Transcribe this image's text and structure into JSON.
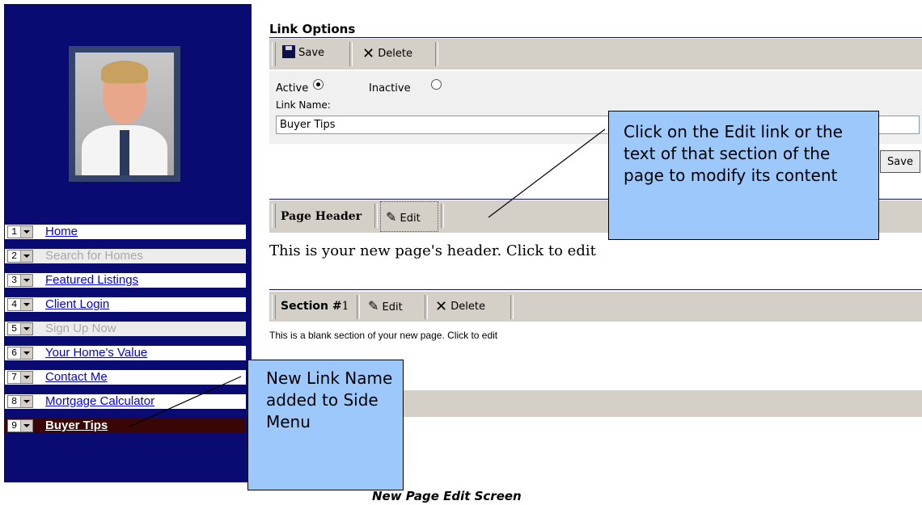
{
  "link_options": {
    "title": "Link Options",
    "save_label": "Save",
    "delete_label": "Delete",
    "active_label": "Active",
    "inactive_label": "Inactive",
    "link_name_label": "Link Name:",
    "link_name_value": "Buyer Tips",
    "save_button_label": "Save"
  },
  "page_header": {
    "title": "Page Header",
    "edit_label": "Edit",
    "content": "This is your new page's header. Click to edit"
  },
  "section1": {
    "title": "Section #",
    "number": "1",
    "edit_label": "Edit",
    "delete_label": "Delete",
    "content": "This is a blank section of your new page. Click to edit"
  },
  "nav": {
    "items": [
      {
        "num": "1",
        "label": "Home",
        "state": "normal"
      },
      {
        "num": "2",
        "label": "Search for Homes",
        "state": "disabled"
      },
      {
        "num": "3",
        "label": "Featured Listings",
        "state": "normal"
      },
      {
        "num": "4",
        "label": "Client Login",
        "state": "normal"
      },
      {
        "num": "5",
        "label": "Sign Up Now",
        "state": "disabled"
      },
      {
        "num": "6",
        "label": "Your Home's Value",
        "state": "normal"
      },
      {
        "num": "7",
        "label": "Contact Me",
        "state": "normal"
      },
      {
        "num": "8",
        "label": "Mortgage Calculator",
        "state": "normal"
      },
      {
        "num": "9",
        "label": "Buyer Tips",
        "state": "selected"
      }
    ]
  },
  "callouts": {
    "edit_tip": "Click on the Edit link or the text of that section of the page to modify its content",
    "new_link_tip": "New Link Name added to Side Menu"
  },
  "caption": "New Page Edit Screen",
  "colors": {
    "sidebar_bg": "#0a0a73",
    "toolbar_bg": "#d4d0c8",
    "callout_bg": "#9dc8fc",
    "selected_row": "#3a0505"
  }
}
